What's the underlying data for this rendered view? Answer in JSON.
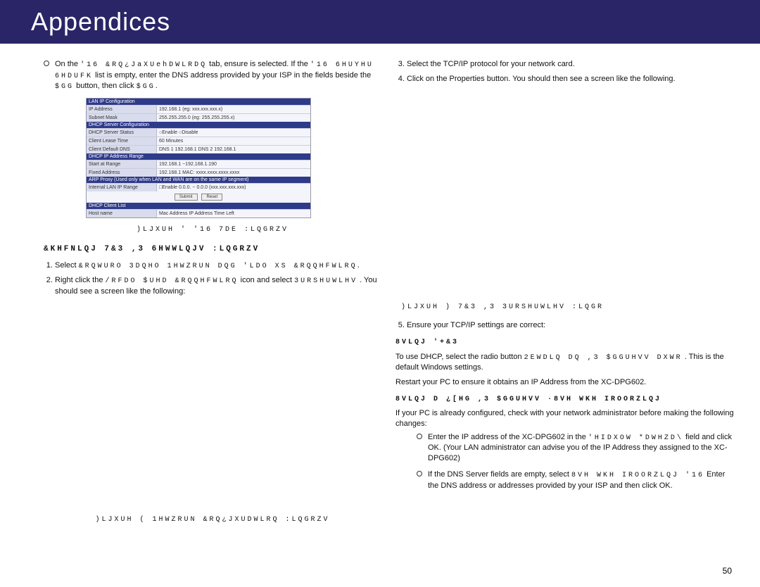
{
  "header": {
    "title": "Appendices"
  },
  "pageNumber": "50",
  "left": {
    "topBullet": {
      "pre": "On the ",
      "g1": "'16 &RQ¿JaXUehDWLRDQ",
      "mid1": " tab, ensure is selected. If the ",
      "g2": "'16 6HUYHU 6HDUFK",
      "mid2": " list is empty, enter the DNS address provided by your ISP in the fields beside the ",
      "g3": "$GG",
      "mid3": " button, then click ",
      "g4": "$GG"
    },
    "lanFigure": {
      "sections": {
        "lan": "LAN IP Configuration",
        "dhcpServer": "DHCP Server Configuration",
        "dhcpRange": "DHCP IP Address Range",
        "arp": "ARP Proxy (Used only when LAN and WAN are on the same IP segment)",
        "client": "DHCP Client List"
      },
      "rows": {
        "ipAddress": {
          "label": "IP Address",
          "val": "192.168.1   (eg: xxx.xxx.xxx.x)"
        },
        "subnet": {
          "label": "Subnet Mask",
          "val": "255.255.255.0  (eg: 255.255.255.x)"
        },
        "dhcpStatus": {
          "label": "DHCP Server Status",
          "val": "○Enable ○Disable"
        },
        "leaseTime": {
          "label": "Client Lease Time",
          "val": "60    Minutes"
        },
        "dns": {
          "label": "Client Default DNS",
          "val": "DNS 1 192.168.1   DNS 2 192.168.1"
        },
        "start": {
          "label": "Start at Range",
          "val": "192.168.1   ~192.168.1.190"
        },
        "fixed": {
          "label": "Fixed Address",
          "val": "192.168.1   MAC: xxxx.xxxx.xxxx.xxxx"
        },
        "internal": {
          "label": "Internal LAN IP Range",
          "val": "□Enable 0.0.0.   ~ 0.0.0   (xxx.xxx.xxx.xxx)"
        },
        "clientHdr": {
          "label": "Host name",
          "val": "Mac Address              IP Address            Time Left"
        }
      },
      "buttons": {
        "submit": "Submit",
        "reset": "Reset"
      }
    },
    "figCaption1": ")LJXUH '  '16 7DE  :LQGRZV",
    "checkingHdr": "&KHFNLQJ 7&3 ,3 6HWWLQJV  :LQGRZV",
    "step1": {
      "pre": "Select ",
      "g": "&RQWURO 3DQHO   1HWZRUN DQG 'LDO XS &RQQHFWLRQ"
    },
    "step2": {
      "pre": "Right click the ",
      "g": "/RFDO $UHD &RQQHFWLRQ",
      "mid": " icon and select ",
      "g2": "3URSHUWLHV",
      "post": ". You should see a screen like the following:"
    },
    "figCaption2": ")LJXUH (  1HWZRUN &RQ¿JXUDWLRQ  :LQGRZV"
  },
  "right": {
    "step3": "Select the TCP/IP protocol for your network card.",
    "step4": "Click on the Properties button. You should then see a screen like the following.",
    "figCaption3": ")LJXUH )  7&3 ,3 3URSHUWLHV  :LQGR",
    "step5": "Ensure your TCP/IP settings are correct:",
    "usingDhcpHdr": "8VLQJ '+&3",
    "dhcp1": {
      "pre": "To use DHCP, select the radio button ",
      "g": "2EWDLQ DQ ,3 $GGUHVV DXWR",
      "post": ". This is the default Windows settings."
    },
    "dhcp2": "Restart your PC to ensure it obtains an IP Address from the XC-DPG602.",
    "fixedHdr": "8VLQJ D ¿[HG ,3 $GGUHVV  ·8VH WKH IROORZLQJ",
    "fixed1": "If your PC is already configured, check with your network administrator before making the following changes:",
    "bullet1": {
      "pre": "Enter the IP address of the XC-DPG602 in the ",
      "g": "'HIDXOW *DWHZD\\",
      "post": " field and click OK. (Your LAN administrator can advise you of the IP Address they assigned to the XC-DPG602)"
    },
    "bullet2": {
      "pre": "If the DNS Server fields are empty, select ",
      "g": "8VH WKH IROORZLQJ '16",
      "post": " Enter the DNS address or addresses provided by your ISP and then click OK."
    }
  }
}
